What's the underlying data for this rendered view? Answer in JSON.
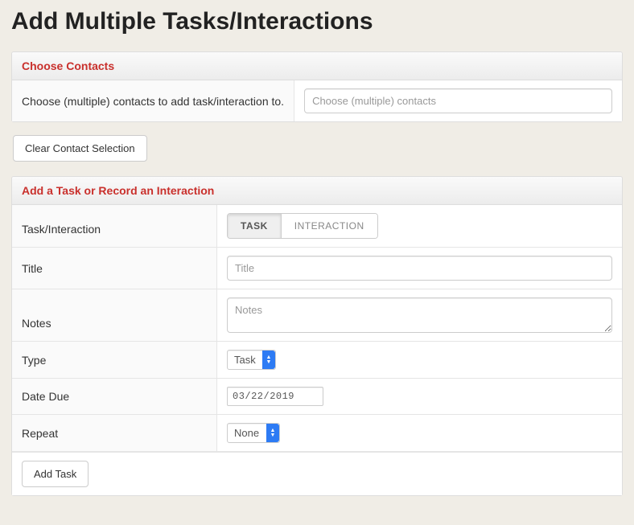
{
  "page_title": "Add Multiple Tasks/Interactions",
  "contacts_panel": {
    "header": "Choose Contacts",
    "label": "Choose (multiple) contacts to add task/interaction to.",
    "placeholder": "Choose (multiple) contacts"
  },
  "clear_button": "Clear Contact Selection",
  "task_panel": {
    "header": "Add a Task or Record an Interaction",
    "row_labels": {
      "task_interaction": "Task/Interaction",
      "title": "Title",
      "notes": "Notes",
      "type": "Type",
      "date_due": "Date Due",
      "repeat": "Repeat"
    },
    "toggle": {
      "task": "TASK",
      "interaction": "INTERACTION"
    },
    "title_placeholder": "Title",
    "notes_placeholder": "Notes",
    "type_value": "Task",
    "date_value": "03/22/2019",
    "repeat_value": "None",
    "add_button": "Add Task"
  }
}
